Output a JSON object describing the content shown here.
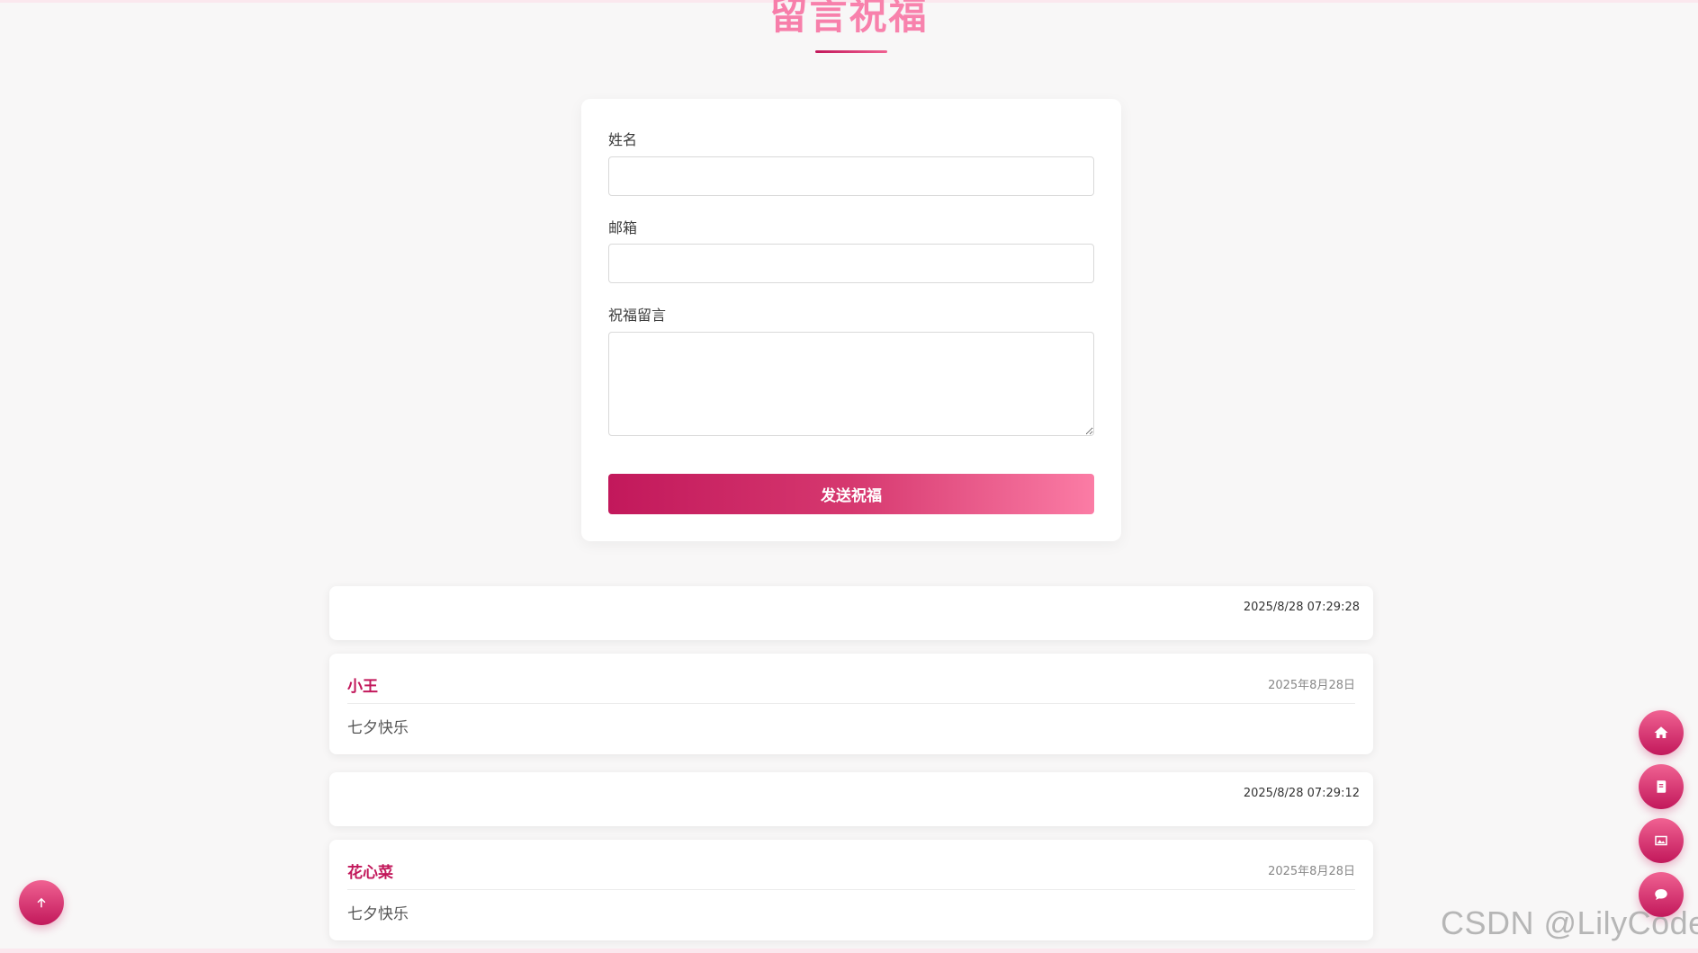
{
  "section": {
    "title": "留言祝福"
  },
  "form": {
    "name_label": "姓名",
    "name_value": "",
    "email_label": "邮箱",
    "email_value": "",
    "message_label": "祝福留言",
    "message_value": "",
    "submit_label": "发送祝福"
  },
  "messages": [
    {
      "type": "timestamp_only",
      "timestamp": "2025/8/28 07:29:28"
    },
    {
      "type": "full",
      "name": "小王",
      "date": "2025年8月28日",
      "text": "七夕快乐"
    },
    {
      "type": "timestamp_only",
      "timestamp": "2025/8/28 07:29:12"
    },
    {
      "type": "full",
      "name": "花心菜",
      "date": "2025年8月28日",
      "text": "七夕快乐"
    }
  ],
  "floating_nav": [
    {
      "icon": "home-icon"
    },
    {
      "icon": "book-icon"
    },
    {
      "icon": "gallery-icon"
    },
    {
      "icon": "chat-icon"
    }
  ],
  "back_to_top": {
    "icon": "arrow-up-icon"
  },
  "watermark": "CSDN @LilyCoder",
  "colors": {
    "accent": "#c2185b",
    "accent_light": "#f06292",
    "title_pink": "#f0669a",
    "background": "#f8f7f7"
  }
}
